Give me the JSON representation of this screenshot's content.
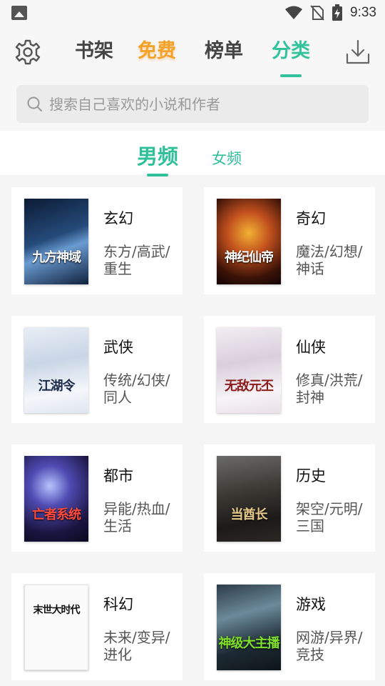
{
  "status_bar": {
    "time": "9:33",
    "icons": [
      "image-icon",
      "wifi-icon",
      "no-sim-icon",
      "battery-charging-icon"
    ]
  },
  "header": {
    "tabs": [
      {
        "label": "书架"
      },
      {
        "label": "免费"
      },
      {
        "label": "榜单"
      },
      {
        "label": "分类"
      }
    ],
    "active_tab": "分类",
    "left_icon": "gear-icon",
    "right_icon": "download-icon"
  },
  "search": {
    "placeholder": "搜索自己喜欢的小说和作者"
  },
  "subtabs": {
    "male": "男频",
    "female": "女频",
    "active": "男频"
  },
  "colors": {
    "accent": "#33c39c",
    "free": "#f4a32a"
  },
  "categories": [
    {
      "name": "玄幻",
      "tags": "东方/高武/重生",
      "cover_title": "九方神域"
    },
    {
      "name": "奇幻",
      "tags": "魔法/幻想/神话",
      "cover_title": "神纪仙帝"
    },
    {
      "name": "武侠",
      "tags": "传统/幻侠/同人",
      "cover_title": "江湖令"
    },
    {
      "name": "仙侠",
      "tags": "修真/洪荒/封神",
      "cover_title": "无敌元丕"
    },
    {
      "name": "都市",
      "tags": "异能/热血/生活",
      "cover_title": "亡者系统"
    },
    {
      "name": "历史",
      "tags": "架空/元明/三国",
      "cover_title": "当酋长"
    },
    {
      "name": "科幻",
      "tags": "未来/变异/进化",
      "cover_title": "末世大时代"
    },
    {
      "name": "游戏",
      "tags": "网游/异界/竞技",
      "cover_title": "神级大主播"
    }
  ]
}
